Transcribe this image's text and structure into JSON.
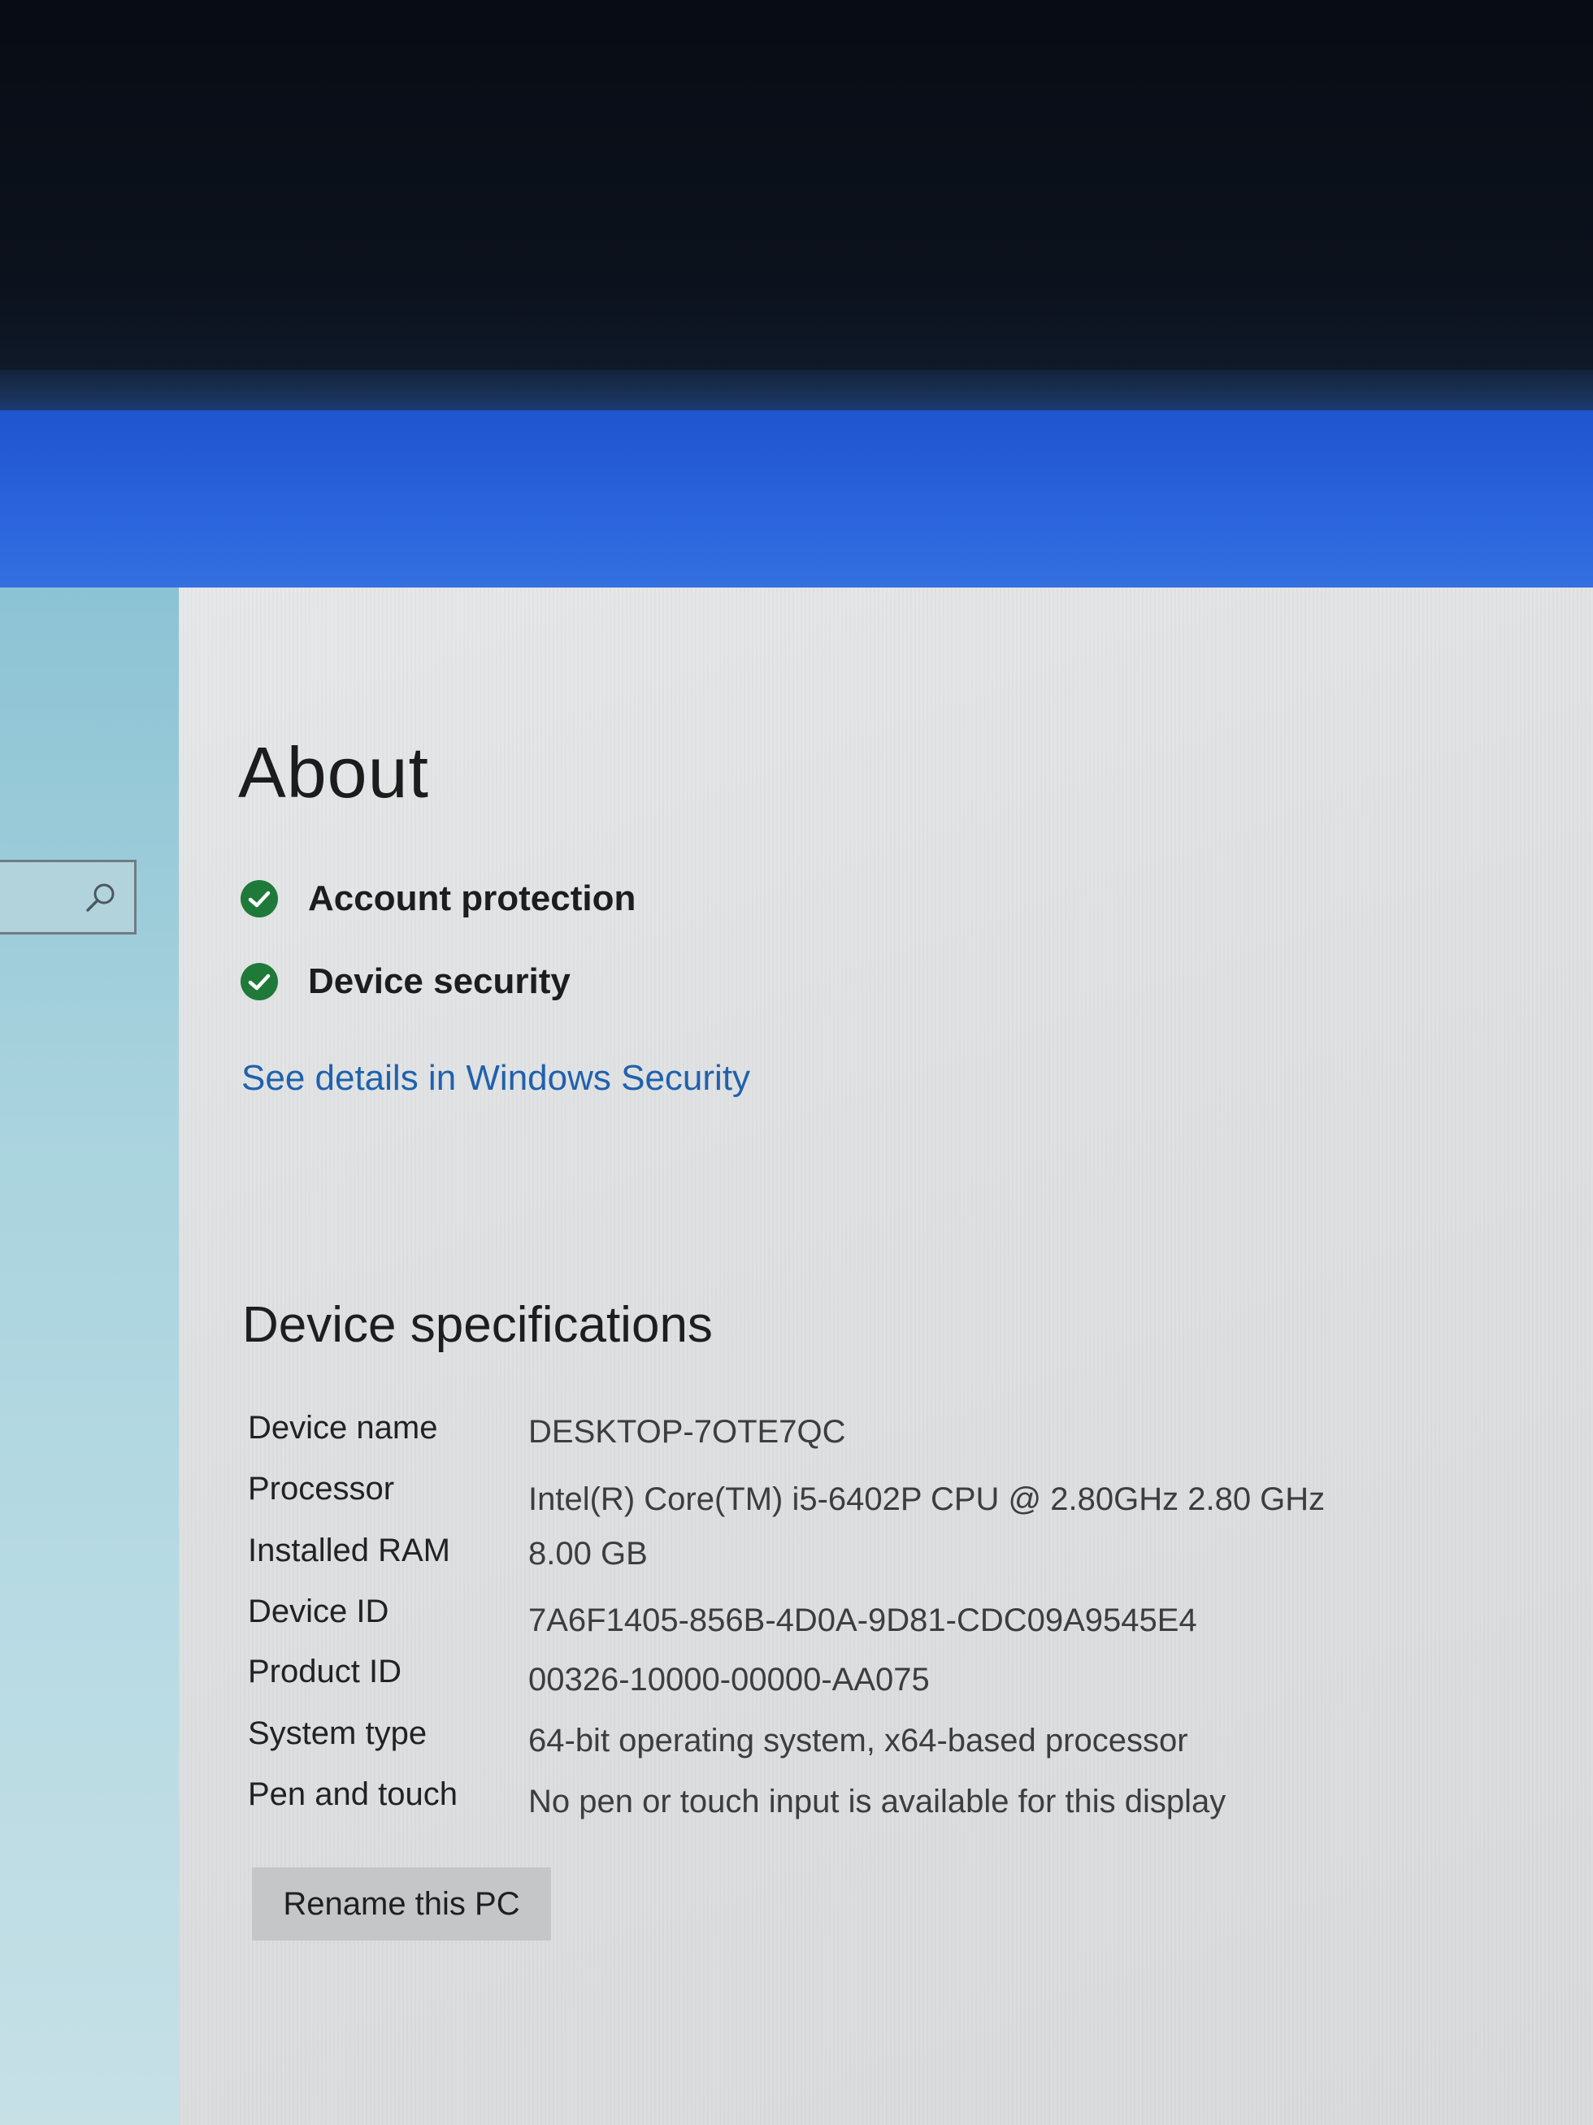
{
  "page": {
    "title": "About"
  },
  "security": {
    "items": [
      {
        "label": "Account protection",
        "status": "ok"
      },
      {
        "label": "Device security",
        "status": "ok"
      }
    ],
    "link_label": "See details in Windows Security"
  },
  "specs": {
    "title": "Device specifications",
    "rows": [
      {
        "label": "Device name",
        "value": "DESKTOP-7OTE7QC"
      },
      {
        "label": "Processor",
        "value": "Intel(R) Core(TM) i5-6402P CPU @ 2.80GHz   2.80 GHz"
      },
      {
        "label": "Installed RAM",
        "value": "8.00 GB"
      },
      {
        "label": "Device ID",
        "value": "7A6F1405-856B-4D0A-9D81-CDC09A9545E4"
      },
      {
        "label": "Product ID",
        "value": "00326-10000-00000-AA075"
      },
      {
        "label": "System type",
        "value": "64-bit operating system, x64-based processor"
      },
      {
        "label": "Pen and touch",
        "value": "No pen or touch input is available for this display"
      }
    ],
    "rename_button_label": "Rename this PC"
  },
  "icons": {
    "search": "search-icon",
    "status_ok": "check-circle-icon"
  },
  "colors": {
    "accent_link": "#1f61ad",
    "status_ok": "#1f7a3a",
    "title_bar": "#2a63dc"
  }
}
